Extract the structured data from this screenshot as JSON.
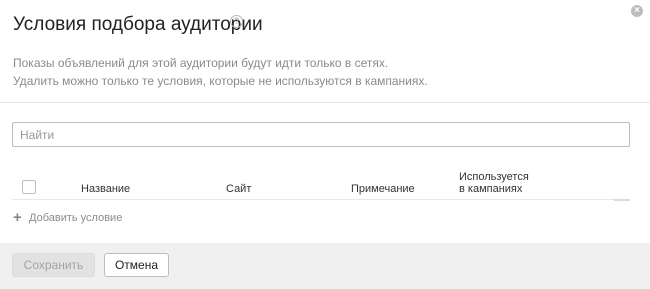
{
  "dialog": {
    "title": "Условия подбора аудитории",
    "help_icon": "?",
    "close_icon": "×",
    "description_line1": "Показы объявлений для этой аудитории будут идти только в сетях.",
    "description_line2": "Удалить можно только те условия, которые не используются в кампаниях."
  },
  "search": {
    "placeholder": "Найти",
    "value": ""
  },
  "table": {
    "columns": {
      "name": "Название",
      "site": "Сайт",
      "note": "Примечание",
      "used_line1": "Используется",
      "used_line2": "в кампаниях"
    },
    "rows": []
  },
  "add_condition": {
    "icon": "+",
    "label": "Добавить условие"
  },
  "footer": {
    "save_label": "Сохранить",
    "cancel_label": "Отмена"
  },
  "colors": {
    "footer_bg": "#f0f0f0",
    "muted_text": "#8a8a8a",
    "disabled_button_bg": "#e2e2e2"
  }
}
